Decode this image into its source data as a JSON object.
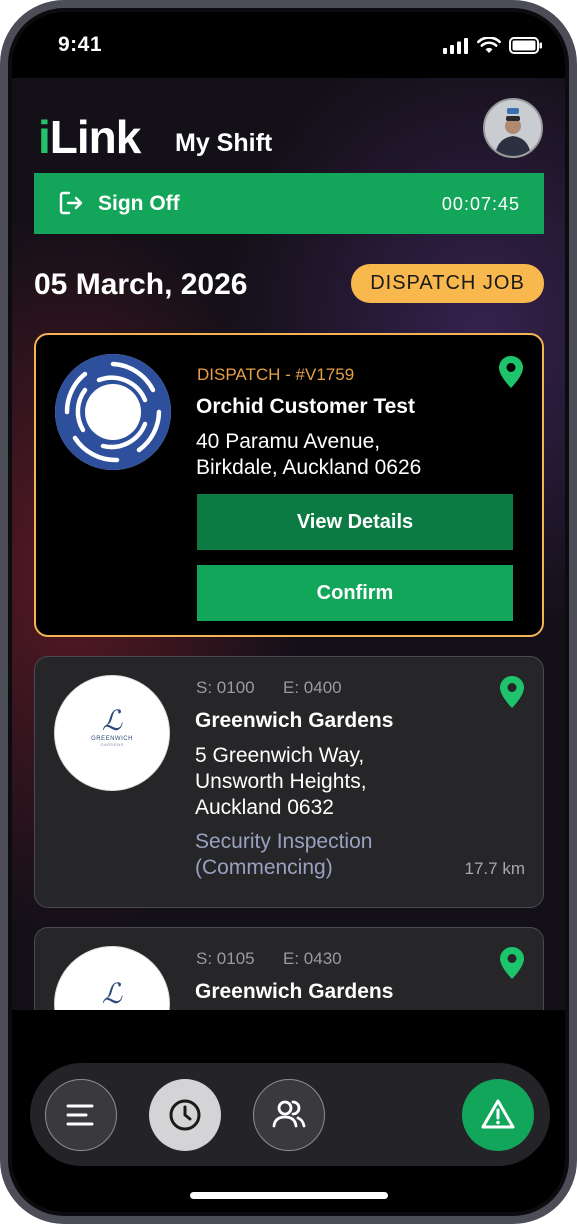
{
  "status_bar": {
    "time": "9:41"
  },
  "header": {
    "logo": "iLink",
    "logo_i": "i",
    "logo_rest": "Link",
    "title": "My Shift"
  },
  "signoff": {
    "label": "Sign Off",
    "timer": "00:07:45"
  },
  "date": "05 March, 2026",
  "dispatch_button": "DISPATCH JOB",
  "jobs": [
    {
      "code": "DISPATCH - #V1759",
      "name": "Orchid Customer Test",
      "address": [
        "40 Paramu Avenue,",
        "Birkdale, Auckland 0626"
      ],
      "view_details": "View Details",
      "confirm": "Confirm"
    },
    {
      "start": "S: 0100",
      "end": "E: 0400",
      "name": "Greenwich Gardens",
      "logo_text": "GREENWICH",
      "logo_sub": "GARDENS",
      "address": [
        "5 Greenwich Way,",
        "Unsworth Heights,",
        "Auckland 0632"
      ],
      "activity": [
        "Security Inspection",
        "(Commencing)"
      ],
      "distance": "17.7 km"
    },
    {
      "start": "S: 0105",
      "end": "E: 0430",
      "name": "Greenwich Gardens"
    }
  ],
  "colors": {
    "brand_green": "#13a65b",
    "accent_orange": "#f8b84e",
    "pin_green": "#1ec46b"
  },
  "icons": [
    "signal-icon",
    "wifi-icon",
    "battery-icon",
    "sign-off-icon",
    "location-pin-icon",
    "menu-icon",
    "clock-icon",
    "users-icon",
    "warning-icon"
  ]
}
